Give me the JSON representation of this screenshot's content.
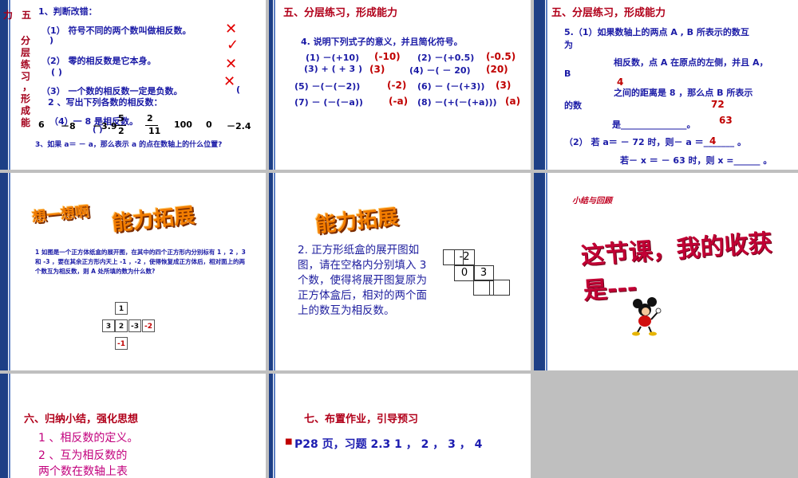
{
  "slide1": {
    "side": [
      "力",
      "五",
      "分",
      "层",
      "练",
      "习",
      "，",
      "形",
      "成",
      "能"
    ],
    "q1": "1、判断改错：",
    "q1a": "（1）  符号不同的两个数叫做相反数。",
    "q1a_paren": ")",
    "q1b": "（2）  零的相反数是它本身。",
    "q1b_paren": "(          )",
    "q1c": "（3）  一个数的相反数一定是负数。",
    "q1c_paren": "(",
    "q2": "2 、写出下列各数的相反数：",
    "q1d": "（4）一 8 是相反数。",
    "q1d_paren": "(          )",
    "numbers": [
      "6",
      "－8",
      "－3.9",
      "5",
      "2",
      "100",
      "0",
      "－2.4"
    ],
    "frac1_den": "2",
    "frac2_den": "11",
    "q3": "3、如果 a＝ －  a，那么表示 a 的点在数轴上的什么位置?",
    "marks": [
      "✕",
      "✓",
      "✕",
      "✕"
    ]
  },
  "slide2": {
    "title": "五、分层练习，形成能力",
    "q4": "4. 说明下列式子的意义，并且简化符号。",
    "rows": [
      {
        "a": "(1)  －(+10)",
        "ra": "(-10)",
        "b": "(2)   －(+0.5)",
        "rb": "(-0.5)"
      },
      {
        "a": "(3) + ( + 3 )",
        "ra": "(3)",
        "b": "(4)   －( － 20)",
        "rb": "(20)"
      },
      {
        "a": "(5)  －(－(－2))",
        "ra": "(-2)",
        "b": "(6)   －  (－(+3))",
        "rb": "(3)"
      },
      {
        "a": "(7)  －  (－(－a))",
        "ra": "(-a)",
        "b": "(8)   －(+(－(+a)))",
        "rb": "(a)"
      }
    ]
  },
  "slide3": {
    "title": "五、分层练习，形成能力",
    "q5a": "5.（1）如果数轴上的两点 A , B 所表示的数互",
    "q5b": "为",
    "q5c": "相反数，点 A 在原点的左侧，并且 A，",
    "q5d": "B",
    "q5e": "之间的距离是 8 ，那么点 B   所表示",
    "q5f": "的数",
    "q5g": "是_______________。",
    "ans4": "4",
    "ans72": "72",
    "ans63": "63",
    "q5h": "（2）  若 a＝ － 72 时，则－ a ＝_______ 。",
    "ans_neg4": "4",
    "q5i": "若－ x ＝  －   63 时，则   x =______ 。"
  },
  "slide4": {
    "think": "想一想啊",
    "ability": "能力拓展",
    "problem": "1 如图是一个正方体纸盒的展开图，在其中的四个正方形内分别标有 1 ，2 ，3 和 -3 ，要在其余正方形内天上 -1 ，-2 ，使得恢复成正方体后，相对面上的两个数互为相反数，则 A 处所填的数为什么数?",
    "cells": [
      "1",
      "3",
      "2",
      "-3",
      "-2",
      "-1"
    ]
  },
  "slide5": {
    "ability": "能力拓展",
    "problem": "2. 正方形纸盒的展开图如图，请在空格内分别填入 3 个数，使得将展开图复原为正方体盒后，相对的两个面上的数互为相反数。",
    "cells": [
      "-2",
      "0",
      "3"
    ]
  },
  "slide6": {
    "small": "小结与回顾",
    "big": "这节课，我的收获是---"
  },
  "slide7": {
    "title": "六、归纳小结，强化思想",
    "l1": "1 、相反数的定义。",
    "l2": "2 、互为相反数的",
    "l3": "两个数在数轴上表"
  },
  "slide8": {
    "title": "七、布置作业，引导预习",
    "bullet": "■",
    "hw": "P28 页，习题 2.3  1 ，  2 ，  3 ，  4"
  }
}
